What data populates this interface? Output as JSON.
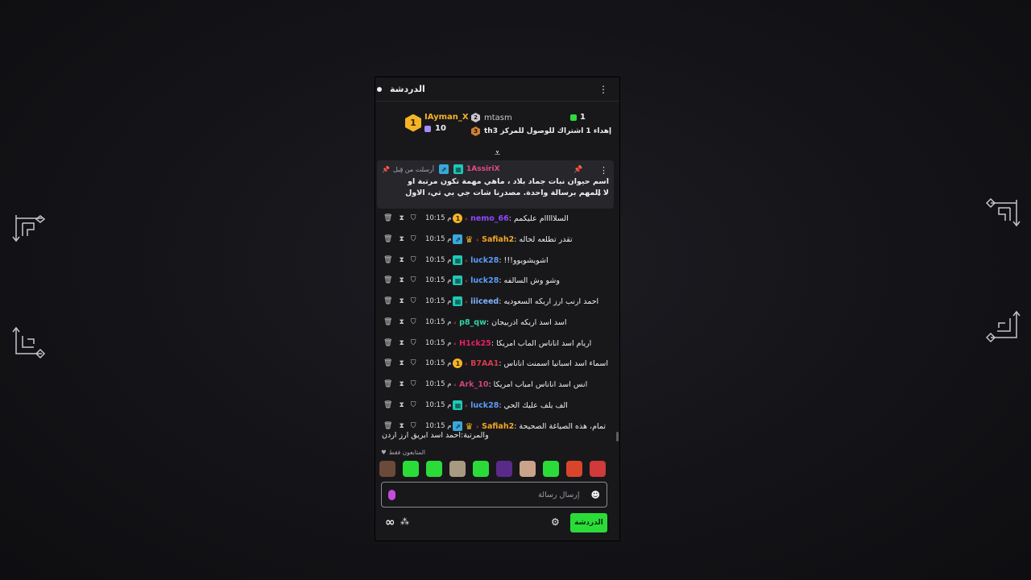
{
  "chat": {
    "title": "الدردشة",
    "header_icon": "chat-bubble-icon",
    "menu_icon": "kebab-icon"
  },
  "leaderboard": {
    "top_user": {
      "name": "IAyman_X",
      "rank": "1",
      "gifts": "10"
    },
    "second_user": {
      "name": "mtasm",
      "rank_badge": "2"
    },
    "gifts_count": "1",
    "goal_text": "thإهداء 1 اشتراك للوصول للمركز 3",
    "goal_rank": "3"
  },
  "pinned": {
    "label": "أرسلت من قِبل",
    "author": "1AssiriX",
    "text": "اسم حيوان نبات جماد بلاد ، ماهي مهمة تكون مرتبة او لا المهم برسالة واحدة. مصدرنا شات جي بي تي، الاول عند سهم هو الفايز، الفايزين الاول..."
  },
  "messages": [
    {
      "time": "10:15 م",
      "badges": [
        "gold-1"
      ],
      "user": "nemo_66",
      "color": "#9147ff",
      "text": "السلااااام عليكمم"
    },
    {
      "time": "10:15 م",
      "badges": [
        "blue",
        "crown"
      ],
      "user": "Safiah2",
      "color": "#f5a623",
      "text": "تقدر تطلعه لحاله"
    },
    {
      "time": "10:15 م",
      "badges": [
        "teal"
      ],
      "user": "luck28",
      "color": "#5b9cf5",
      "text": "اشويشويوو!!!"
    },
    {
      "time": "10:15 م",
      "badges": [
        "teal"
      ],
      "user": "luck28",
      "color": "#5b9cf5",
      "text": "وشو وش السالفه"
    },
    {
      "time": "10:15 م",
      "badges": [
        "teal"
      ],
      "user": "iiiceed",
      "color": "#7fb3ff",
      "text": "احمد ارنب ارز اريكه السعوديه"
    },
    {
      "time": "10:15 م",
      "badges": [],
      "user": "p8_qw",
      "color": "#2fd4a8",
      "text": "اسد اسد اريكه اذربيجان"
    },
    {
      "time": "10:15 م",
      "badges": [],
      "user": "H1ck25",
      "color": "#e91e63",
      "text": "اريام اسد اناناس الماب امريكا"
    },
    {
      "time": "10:15 م",
      "badges": [
        "gold-1"
      ],
      "user": "B7AA1",
      "color": "#d63a4a",
      "text": "اسماء اسد اسبانيا اسمنت اناناس"
    },
    {
      "time": "10:15 م",
      "badges": [],
      "user": "Ark_10",
      "color": "#d0417f",
      "text": "انس اسد اناناس امباب امريكا"
    },
    {
      "time": "10:15 م",
      "badges": [
        "teal"
      ],
      "user": "luck28",
      "color": "#5b9cf5",
      "text": "الف يلف عليك الحي"
    },
    {
      "time": "10:15 م",
      "badges": [
        "blue",
        "crown"
      ],
      "user": "Safiah2",
      "color": "#f5a623",
      "text": "تمام، هذه الصياغة الصحيحة"
    }
  ],
  "last_message_wrap": "والمرتبة:احمد اسد ابريق ارز اردن",
  "emotes_label": "المتابعون فقط",
  "emotes": [
    {
      "name": "emote-face-icon",
      "bg": "#6b4a3a"
    },
    {
      "name": "emote-green-blob-icon",
      "bg": "#2bdc39"
    },
    {
      "name": "emote-green-clock-icon",
      "bg": "#2bdc39"
    },
    {
      "name": "emote-photo-icon",
      "bg": "#a89a80"
    },
    {
      "name": "emote-green-sad-icon",
      "bg": "#2bdc39"
    },
    {
      "name": "emote-purple-icon",
      "bg": "#5a2a8a"
    },
    {
      "name": "emote-person-icon",
      "bg": "#c9a38a"
    },
    {
      "name": "emote-green-smile-icon",
      "bg": "#2bdc39"
    },
    {
      "name": "emote-red-face-icon",
      "bg": "#d9452a"
    },
    {
      "name": "emote-red-box-icon",
      "bg": "#d03a3a"
    }
  ],
  "input": {
    "placeholder": "إرسال رسالة"
  },
  "footer": {
    "chat_button": "الدردشة"
  },
  "colors": {
    "accent": "#2bdc39",
    "panel_bg": "#18181b",
    "page_bg": "#141418"
  }
}
